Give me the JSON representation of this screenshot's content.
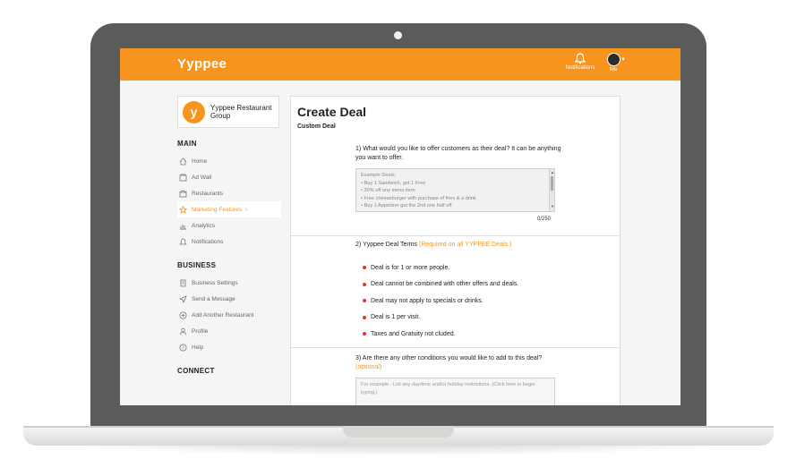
{
  "app": {
    "brand": "Yyppee"
  },
  "header": {
    "notifications_label": "Notifications",
    "me_label": "Me"
  },
  "org": {
    "logo_letter": "y",
    "name": "Yyppee Restaurant Group"
  },
  "sidebar": {
    "main_heading": "MAIN",
    "main_items": [
      {
        "label": "Home",
        "icon": "home-icon"
      },
      {
        "label": "Ad Wall",
        "icon": "ad-wall-icon"
      },
      {
        "label": "Restaurants",
        "icon": "restaurant-icon"
      },
      {
        "label": "Marketing Features",
        "icon": "star-icon",
        "active": true
      },
      {
        "label": "Analytics",
        "icon": "analytics-icon"
      },
      {
        "label": "Notifications",
        "icon": "bell-icon"
      }
    ],
    "business_heading": "BUSINESS",
    "business_items": [
      {
        "label": "Business Settings",
        "icon": "building-icon"
      },
      {
        "label": "Send a Message",
        "icon": "send-icon"
      },
      {
        "label": "Add Another Restaurant",
        "icon": "plus-circle-icon"
      },
      {
        "label": "Profile",
        "icon": "user-icon"
      },
      {
        "label": "Help",
        "icon": "help-icon"
      }
    ],
    "connect_heading": "CONNECT"
  },
  "main": {
    "title": "Create Deal",
    "subtitle": "Custom Deal",
    "q1": {
      "number": "1)",
      "text": "What would you like to offer customers as their deal? It can be anything you want to offer."
    },
    "q1_placeholder_lines": [
      "Example Deals:",
      "• Buy 1 Sandwich, get 1 Free",
      "• 30% off any menu item",
      "• Free cheeseburger with purchase of fries & a drink",
      "• Buy 1 Appetizer get the 2nd one half off"
    ],
    "q1_counter": "0/250",
    "q2": {
      "number": "2)",
      "text": "Yyppee Deal Terms",
      "note": "(Required on all YYPPEE Deals.)"
    },
    "terms": [
      "Deal is for 1 or more people.",
      "Deal cannot be combined with other offers and deals.",
      "Deal may not apply to specials or drinks.",
      "Deal is 1 per visit.",
      "Taxes and Gratuity not cluded."
    ],
    "q3": {
      "number": "3)",
      "text": "Are there any other conditions you would like to add to this deal?",
      "note": "(optional)"
    },
    "q3_placeholder": "For example - List any day/time and/or holiday restrictions. (Click here to begin typing.)"
  },
  "colors": {
    "accent": "#f7941d",
    "bullet": "#e63333"
  }
}
